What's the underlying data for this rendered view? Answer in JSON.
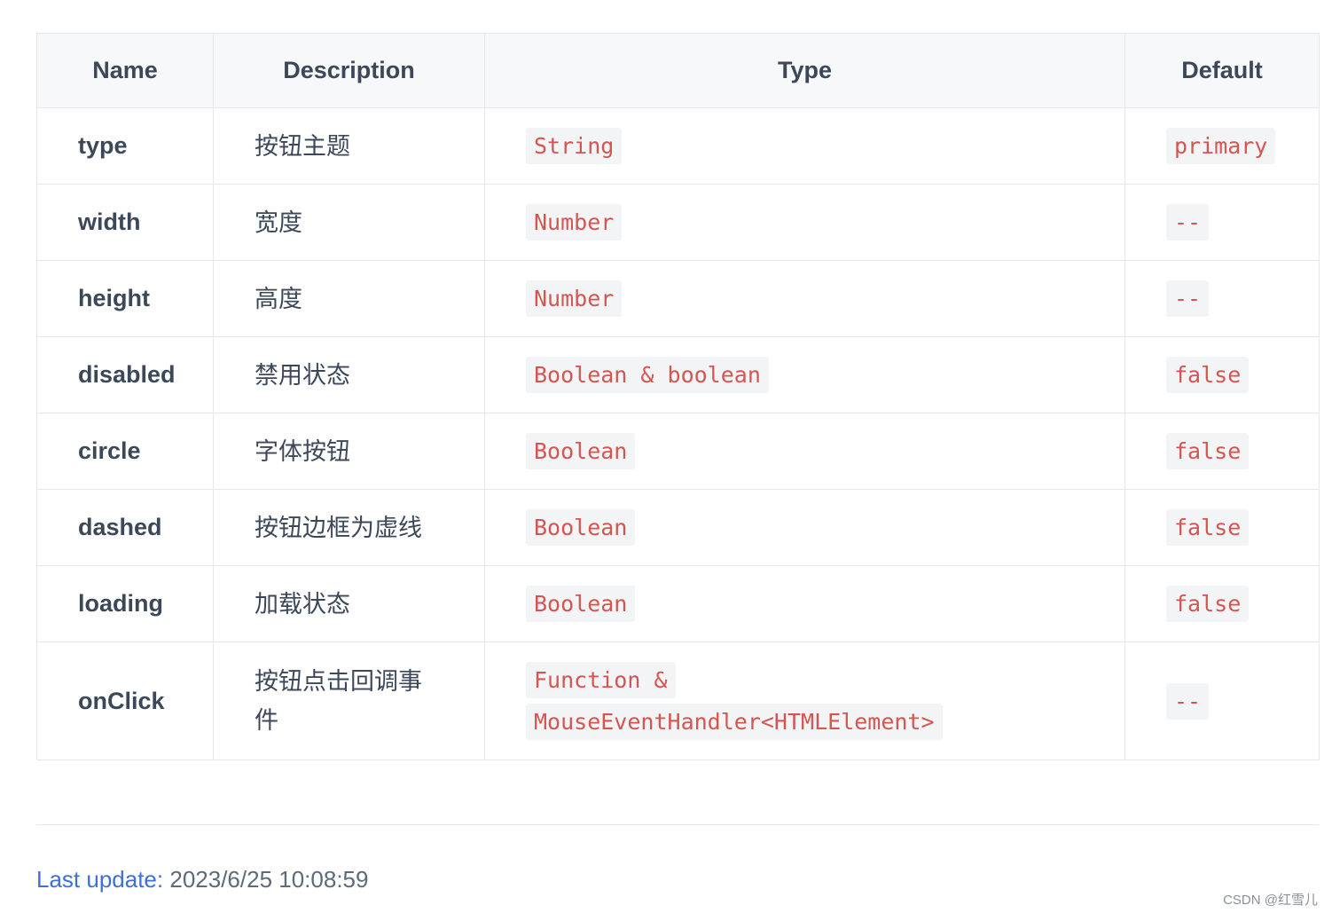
{
  "table": {
    "headers": {
      "name": "Name",
      "description": "Description",
      "type": "Type",
      "default": "Default"
    },
    "rows": [
      {
        "name": "type",
        "description": "按钮主题",
        "type": "String",
        "default": "primary"
      },
      {
        "name": "width",
        "description": "宽度",
        "type": "Number",
        "default": "--"
      },
      {
        "name": "height",
        "description": "高度",
        "type": "Number",
        "default": "--"
      },
      {
        "name": "disabled",
        "description": "禁用状态",
        "type": "Boolean & boolean",
        "default": "false"
      },
      {
        "name": "circle",
        "description": "字体按钮",
        "type": "Boolean",
        "default": "false"
      },
      {
        "name": "dashed",
        "description": "按钮边框为虚线",
        "type": "Boolean",
        "default": "false"
      },
      {
        "name": "loading",
        "description": "加载状态",
        "type": "Boolean",
        "default": "false"
      },
      {
        "name": "onClick",
        "description": "按钮点击回调事件",
        "type": "Function & MouseEventHandler<HTMLElement>",
        "default": "--"
      }
    ]
  },
  "footer": {
    "last_update_label": "Last update:",
    "last_update_value": "2023/6/25 10:08:59"
  },
  "watermark": "CSDN @红雪儿",
  "colors": {
    "code_text": "#d55550",
    "code_bg": "#f3f4f5",
    "header_bg": "#f6f8fa",
    "link_blue": "#3f6fd8",
    "border": "#e5e7eb"
  }
}
